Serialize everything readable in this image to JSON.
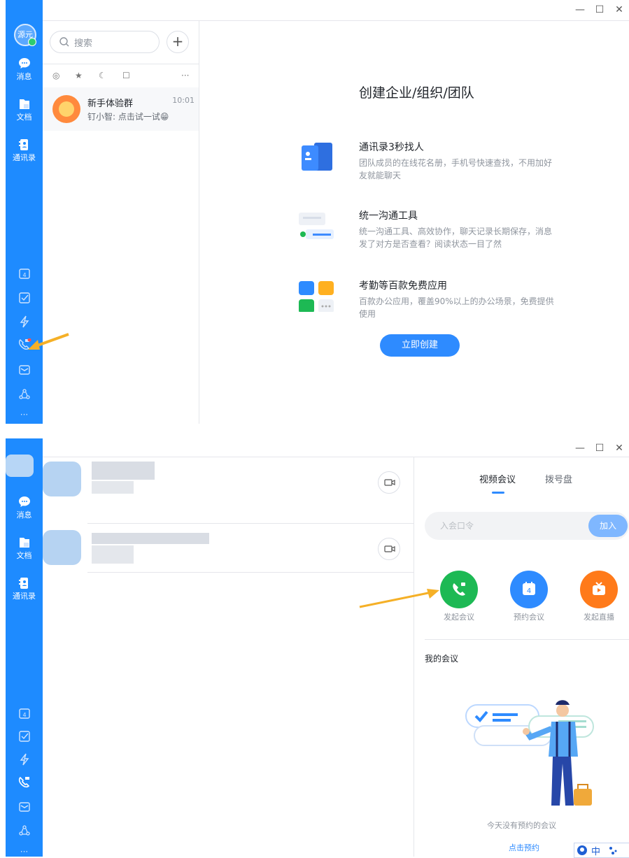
{
  "window_controls": {
    "minimize": "—",
    "maximize": "☐",
    "close": "✕"
  },
  "panel1": {
    "sidebar": {
      "avatar_text": "源元",
      "items": [
        {
          "label": "消息",
          "icon": "chat-bubble-icon"
        },
        {
          "label": "文档",
          "icon": "document-icon"
        },
        {
          "label": "通讯录",
          "icon": "contacts-icon"
        }
      ],
      "bottom_icons": [
        "calendar-icon",
        "todo-icon",
        "lightning-icon",
        "video-call-icon",
        "mail-icon",
        "org-icon",
        "more-icon"
      ],
      "calendar_day": "4",
      "more": "···"
    },
    "search": {
      "placeholder": "搜索",
      "add": "+"
    },
    "filters": [
      "◎",
      "★",
      "☾",
      "☐",
      "···"
    ],
    "chat": {
      "name": "新手体验群",
      "time": "10:01",
      "message": "钉小智: 点击试一试😁"
    },
    "create": {
      "title": "创建企业/组织/团队",
      "features": [
        {
          "title": "通讯录3秒找人",
          "desc": "团队成员的在线花名册，手机号快速查找，不用加好友就能聊天"
        },
        {
          "title": "统一沟通工具",
          "desc": "统一沟通工具、高效协作，聊天记录长期保存，消息发了对方是否查看？阅读状态一目了然"
        },
        {
          "title": "考勤等百款免费应用",
          "desc": "百款办公应用，覆盖90%以上的办公场景，免费提供使用"
        }
      ],
      "button": "立即创建"
    }
  },
  "panel2": {
    "sidebar": {
      "items": [
        {
          "label": "消息",
          "icon": "chat-bubble-icon"
        },
        {
          "label": "文档",
          "icon": "document-icon"
        },
        {
          "label": "通讯录",
          "icon": "contacts-icon"
        }
      ],
      "calendar_day": "4",
      "more": "···"
    },
    "tabs": [
      "视频会议",
      "拨号盘"
    ],
    "join": {
      "placeholder": "入会口令",
      "button": "加入"
    },
    "actions": [
      {
        "label": "发起会议",
        "color": "#1db954",
        "icon": "phone-icon"
      },
      {
        "label": "预约会议",
        "color": "#2e8bff",
        "icon": "calendar-icon",
        "day": "4"
      },
      {
        "label": "发起直播",
        "color": "#ff7a1a",
        "icon": "live-tv-icon"
      }
    ],
    "my_meetings": "我的会议",
    "empty_text": "今天没有预约的会议",
    "book_link": "点击预约",
    "ime": "中"
  },
  "colors": {
    "sidebar": "#1e8bff",
    "accent": "#2e8bff",
    "arrow": "#f5b027"
  }
}
